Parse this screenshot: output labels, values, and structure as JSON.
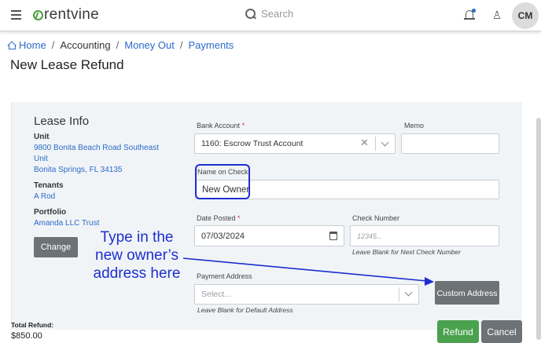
{
  "header": {
    "logo_text": "rentvine",
    "search_placeholder": "Search",
    "avatar_initials": "CM",
    "accent_color": "#2a6bc9",
    "brand_color": "#4a9d3a"
  },
  "breadcrumb": {
    "home": "Home",
    "accounting": "Accounting",
    "money_out": "Money Out",
    "payments": "Payments"
  },
  "page": {
    "title": "New Lease Refund"
  },
  "lease_info": {
    "title": "Lease Info",
    "unit_label": "Unit",
    "unit_line1": "9800 Bonita Beach Road Southeast",
    "unit_line2": "Unit",
    "unit_line3": "Bonita Springs, FL 34135",
    "tenants_label": "Tenants",
    "tenant_name": "A Rod",
    "portfolio_label": "Portfolio",
    "portfolio_name": "Amanda LLC Trust",
    "change_button": "Change"
  },
  "form": {
    "bank_account_label": "Bank Account",
    "bank_account_value": "1160: Escrow Trust Account",
    "memo_label": "Memo",
    "memo_value": "",
    "name_on_check_label": "Name on Check",
    "name_on_check_value": "New Owner",
    "date_posted_label": "Date Posted",
    "date_posted_value": "07/03/2024",
    "check_number_label": "Check Number",
    "check_number_placeholder": "12345...",
    "check_number_hint": "Leave Blank for Next Check Number",
    "payment_address_label": "Payment Address",
    "payment_address_placeholder": "Select...",
    "payment_address_hint": "Leave Blank for Default Address",
    "custom_address_button": "Custom Address",
    "required_marker": "*"
  },
  "annotation": {
    "text": "Type in the new owner’s address here",
    "color": "#1b2fd0"
  },
  "footer": {
    "total_label": "Total Refund:",
    "total_value": "$850.00",
    "refund_button": "Refund",
    "cancel_button": "Cancel"
  }
}
